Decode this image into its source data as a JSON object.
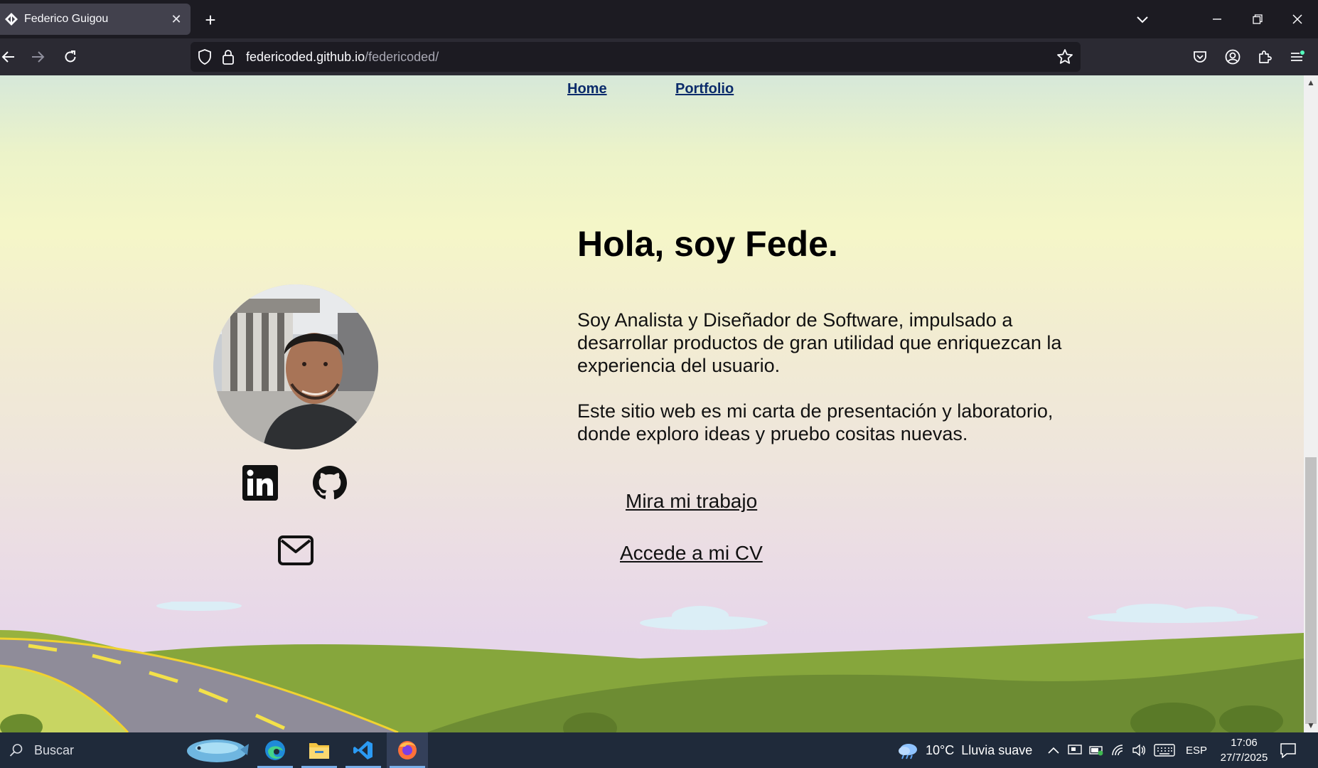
{
  "browser": {
    "tab_title": "Federico Guigou",
    "url_host": "federicoded.github.io",
    "url_path": "/federicoded/"
  },
  "page": {
    "nav": {
      "home": "Home",
      "portfolio": "Portfolio"
    },
    "title": "Hola, soy Fede.",
    "paragraph_1": "Soy Analista y Diseñador de Software, impulsado a desarrollar productos de gran utilidad que enriquezcan la experiencia del usuario.",
    "paragraph_2": "Este sitio web es mi carta de presentación y laboratorio, donde exploro ideas y pruebo cositas nuevas.",
    "cta_work": "Mira mi trabajo",
    "cta_cv": "Accede a mi CV",
    "social": [
      "linkedin-icon",
      "github-icon",
      "mail-icon"
    ]
  },
  "taskbar": {
    "search_placeholder": "Buscar",
    "weather": "10°C  Lluvia suave",
    "language": "ESP",
    "time": "17:06",
    "date": "27/7/2025"
  },
  "colors": {
    "link_nav": "#0b2b6b",
    "tab_bg": "#42414d",
    "urlbar_bg": "#1c1b22",
    "taskbar_bg": "#1f2a3a"
  }
}
